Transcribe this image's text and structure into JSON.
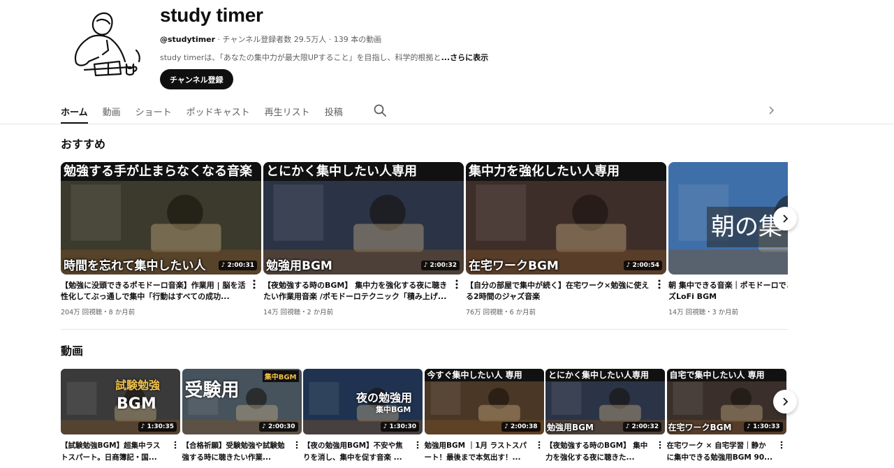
{
  "channel": {
    "name": "study timer",
    "handle": "@studytimer",
    "meta": " · チャンネル登録者数 29.5万人 · 139 本の動画",
    "description": "study timerは、「あなたの集中力が最大限UPすること」を目指し、科学的根拠と",
    "more_label": "...さらに表示",
    "subscribe_label": "チャンネル登録"
  },
  "tabs": [
    "ホーム",
    "動画",
    "ショート",
    "ポッドキャスト",
    "再生リスト",
    "投稿"
  ],
  "icons": {
    "search": "search-icon",
    "tabs_next": "chevron-right-icon",
    "rail_next": "chevron-right-icon",
    "more": "more-vert-icon"
  },
  "sections": {
    "recommended": {
      "title": "おすすめ",
      "videos": [
        {
          "top_text": "勉強する手が止まらなくなる音楽",
          "bottom_text": "時間を忘れて集中したい人",
          "duration": "2:00:31",
          "title": "【勉強に没頭できるポモドーロ音楽】作業用 | 脳を活性化してぶっ通しで集中「行動はすべての成功...",
          "meta": "204万 回視聴・8 か月前",
          "theme": "#3b3a2c"
        },
        {
          "top_text": "とにかく集中したい人専用",
          "bottom_text": "勉強用BGM",
          "duration": "2:00:32",
          "title": "【夜勉強する時のBGM】 集中力を強化する夜に聴きたい作業用音楽 /ポモドーロテクニック「積み上げ...",
          "meta": "14万 回視聴・2 か月前",
          "theme": "#2b3446"
        },
        {
          "top_text": "集中力を強化したい人専用",
          "bottom_text": "在宅ワークBGM",
          "duration": "2:00:54",
          "title": "【自分の部屋で集中が続く】在宅ワーク×勉強に使える2時間のジャズ音楽",
          "meta": "76万 回視聴・6 か月前",
          "theme": "#3e2e2a"
        },
        {
          "top_text": "",
          "bottom_text": "朝の集",
          "duration": "",
          "title": "朝 集中できる音楽｜ポモドーロでどる｜静かなジャズLoFi BGM",
          "meta": "14万 回視聴・3 か月前",
          "theme": "#3f6fa8"
        }
      ]
    },
    "videos": {
      "title": "動画",
      "items": [
        {
          "top_text": "試験勉強",
          "bottom_text": "BGM",
          "duration": "1:30:35",
          "title": "【試験勉強BGM】超集中ラストスパート。日商簿記・国...",
          "theme": "#3a3a3a"
        },
        {
          "top_text": "受験用",
          "bottom_text": "集中BGM",
          "duration": "2:00:30",
          "title": "【合格祈願】受験勉強や試験勉強する時に聴きたい作業...",
          "theme": "#46525c"
        },
        {
          "top_text": "夜の勉強用",
          "bottom_text": "集中BGM",
          "duration": "1:30:30",
          "title": "【夜の勉強用BGM】不安や焦りを消し、集中を促す音楽 ...",
          "theme": "#1f3350"
        },
        {
          "top_text": "今すぐ集中したい人 専用",
          "bottom_text": "",
          "duration": "2:00:38",
          "title": "勉強用BGM ｜1月 ラストスパート！最後まで本気出す！...",
          "theme": "#4a3726"
        },
        {
          "top_text": "とにかく集中したい人専用",
          "bottom_text": "勉強用BGM",
          "duration": "2:00:32",
          "title": "【夜勉強する時のBGM】 集中力を強化する夜に聴きた...",
          "theme": "#2b3446"
        },
        {
          "top_text": "自宅で集中したい人 専用",
          "bottom_text": "在宅ワークBGM",
          "duration": "1:30:33",
          "title": "在宅ワーク × 自宅学習｜静かに集中できる勉強用BGM 90...",
          "theme": "#3a2f2b"
        }
      ]
    }
  }
}
